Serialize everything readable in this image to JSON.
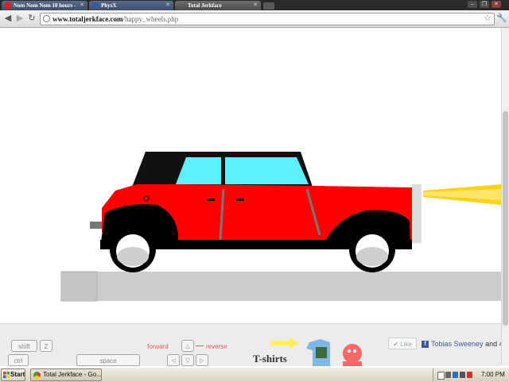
{
  "browser": {
    "tabs": [
      {
        "title": "Nom Nom Nom 10 hours -",
        "favicon": "youtube-icon"
      },
      {
        "title": "PhysX",
        "favicon": "facebook-icon"
      },
      {
        "title": "Total Jerkface",
        "favicon": "page-icon",
        "active": true
      }
    ],
    "url_domain": "www.totaljerkface.com",
    "url_path": "/happy_wheels.php"
  },
  "game": {
    "colors": {
      "car_body": "#ff0000",
      "car_roof": "#111111",
      "car_window": "#5ff0ff",
      "headlight_beam": "#ffd21a",
      "platform": "#cccccc"
    },
    "icons": [
      "car-sprite",
      "headlight-beam",
      "platform-block"
    ]
  },
  "controls": {
    "keys": {
      "shift": "shift",
      "z": "Z",
      "ctrl": "ctrl",
      "space": "space"
    },
    "labels": {
      "forward": "forward",
      "reverse": "reverse"
    },
    "promo": {
      "tshirts": "T-shirts"
    },
    "social": {
      "like_label": "Like",
      "fb_name": "Tobias Sweeney",
      "fb_rest": "and 4"
    }
  },
  "taskbar": {
    "start_label": "Start",
    "task_item": "Total Jerkface - Go...",
    "clock": "7:00 PM"
  }
}
